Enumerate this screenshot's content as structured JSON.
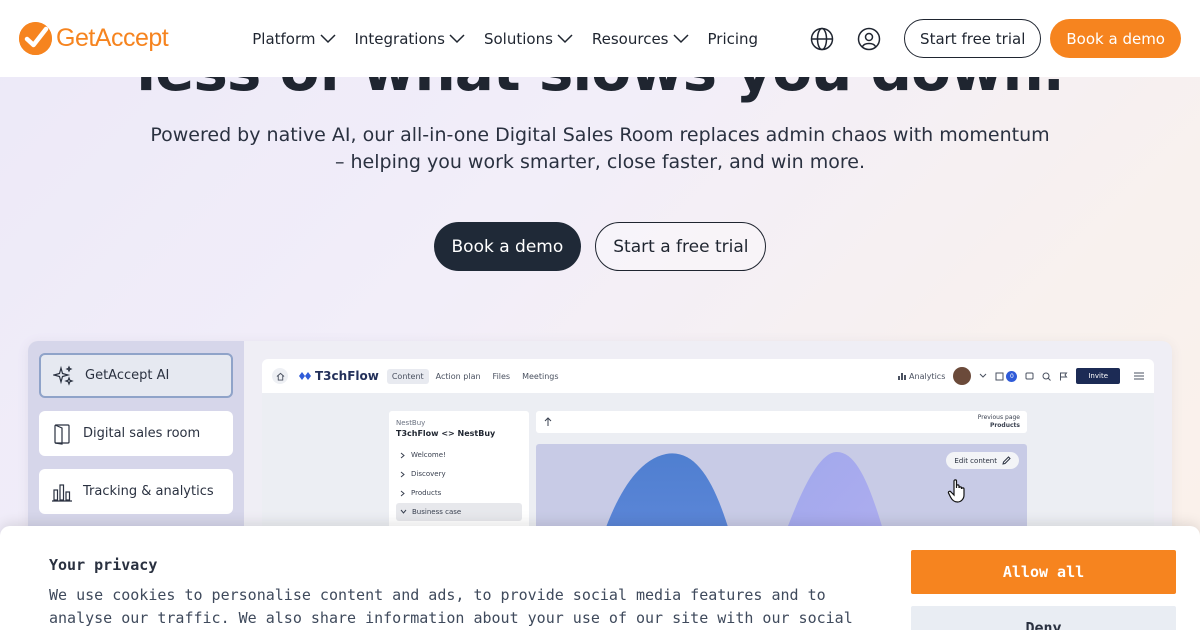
{
  "header": {
    "logo_text": "GetAccept",
    "nav": [
      {
        "label": "Platform",
        "has_dropdown": true
      },
      {
        "label": "Integrations",
        "has_dropdown": true
      },
      {
        "label": "Solutions",
        "has_dropdown": true
      },
      {
        "label": "Resources",
        "has_dropdown": true
      },
      {
        "label": "Pricing",
        "has_dropdown": false
      }
    ],
    "icons": [
      "globe-icon",
      "user-icon"
    ],
    "start_trial_label": "Start free trial",
    "book_demo_label": "Book a demo"
  },
  "hero": {
    "title_partial": "less of what slows you down.",
    "subtitle": "Powered by native AI, our all-in-one Digital Sales Room replaces admin chaos with momentum – helping you work smarter, close faster, and win more.",
    "book_demo_label": "Book a demo",
    "start_trial_label": "Start a free trial"
  },
  "features": [
    {
      "label": "GetAccept AI",
      "icon": "sparkles-icon",
      "active": true
    },
    {
      "label": "Digital sales room",
      "icon": "door-icon",
      "active": false
    },
    {
      "label": "Tracking & analytics",
      "icon": "bar-chart-icon",
      "active": false
    }
  ],
  "app_preview": {
    "brand": "T3chFlow",
    "tabs": [
      {
        "label": "Content",
        "active": true
      },
      {
        "label": "Action plan",
        "active": false
      },
      {
        "label": "Files",
        "active": false
      },
      {
        "label": "Meetings",
        "active": false
      }
    ],
    "analytics_label": "Analytics",
    "notification_count": "0",
    "invite_label": "Invite",
    "room_caption": "NestBuy",
    "room_title": "T3chFlow <> NestBuy",
    "sections": [
      {
        "label": "Welcome!",
        "selected": false
      },
      {
        "label": "Discovery",
        "selected": false
      },
      {
        "label": "Products",
        "selected": false
      },
      {
        "label": "Business case",
        "selected": true
      }
    ],
    "previous_page_label": "Previous page",
    "previous_page_name": "Products",
    "edit_content_label": "Edit content"
  },
  "cookie": {
    "title": "Your privacy",
    "text": "We use cookies to personalise content and ads, to provide social media features and to analyse our traffic. We also share information about your use of our site with our social media, advertising and analytics partners who",
    "allow_label": "Allow all",
    "deny_label": "Deny"
  },
  "colors": {
    "brand_orange": "#f6841f",
    "dark": "#1f2937"
  }
}
